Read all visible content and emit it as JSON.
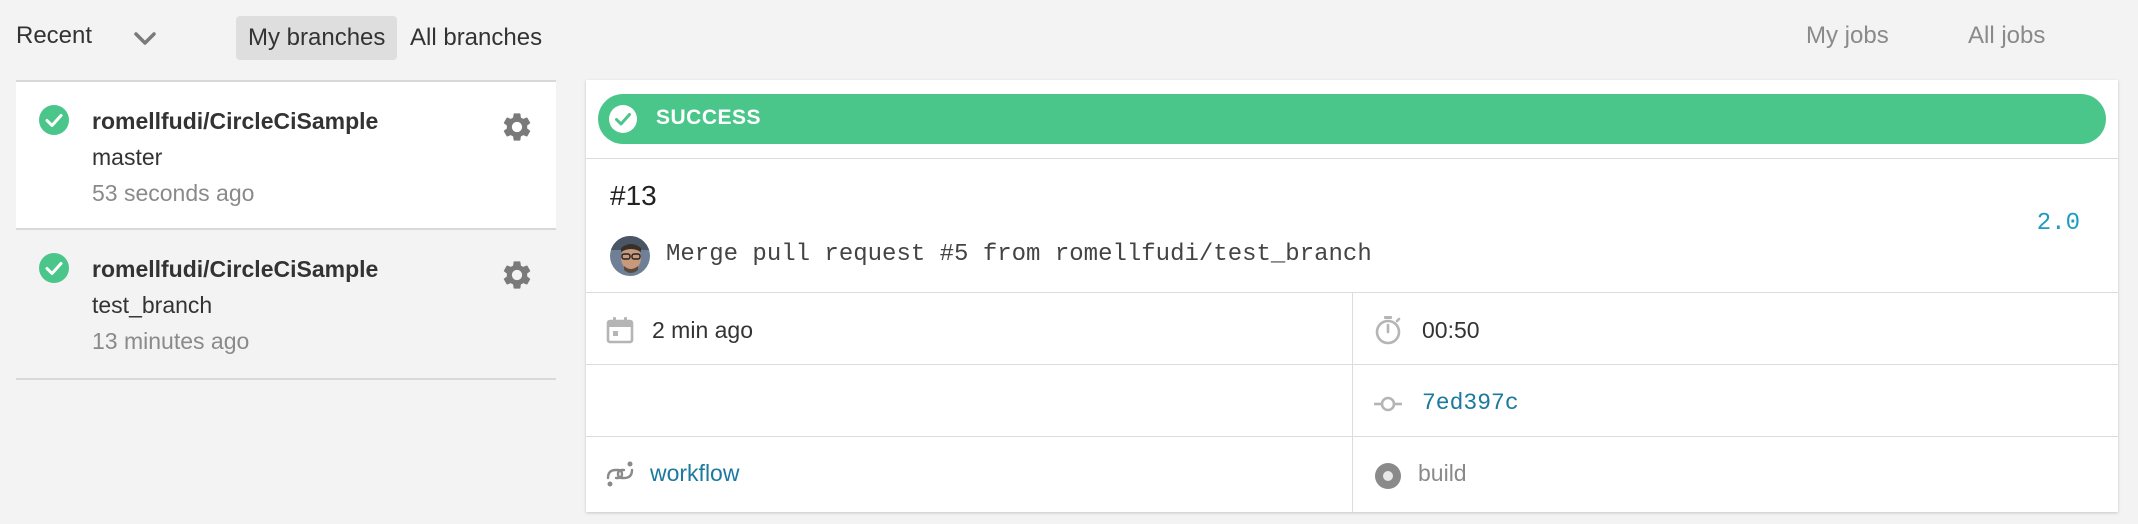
{
  "header": {
    "recent_label": "Recent",
    "tabs": [
      {
        "label": "My branches",
        "active": true
      },
      {
        "label": "All branches",
        "active": false
      }
    ],
    "job_links": [
      "My jobs",
      "All jobs"
    ]
  },
  "branches": [
    {
      "repo": "romellfudi/CircleCiSample",
      "branch": "master",
      "time": "53 seconds ago",
      "status": "success"
    },
    {
      "repo": "romellfudi/CircleCiSample",
      "branch": "test_branch",
      "time": "13 minutes ago",
      "status": "success"
    }
  ],
  "build": {
    "status": "SUCCESS",
    "number": "#13",
    "commit_message": "Merge pull request #5 from romellfudi/test_branch",
    "version": "2.0",
    "started": "2 min ago",
    "duration": "00:50",
    "commit_hash": "7ed397c",
    "workflow_label": "workflow",
    "job_label": "build"
  },
  "colors": {
    "success": "#4bc68a",
    "link": "#1b7a9e",
    "version": "#1f9bbf"
  },
  "icons": {
    "dropdown": "chevron-down-icon",
    "status": "check-circle-icon",
    "settings": "gear-icon",
    "calendar": "calendar-icon",
    "timer": "stopwatch-icon",
    "commit": "commit-icon",
    "workflow": "workflow-icon",
    "job": "job-dot-icon"
  }
}
